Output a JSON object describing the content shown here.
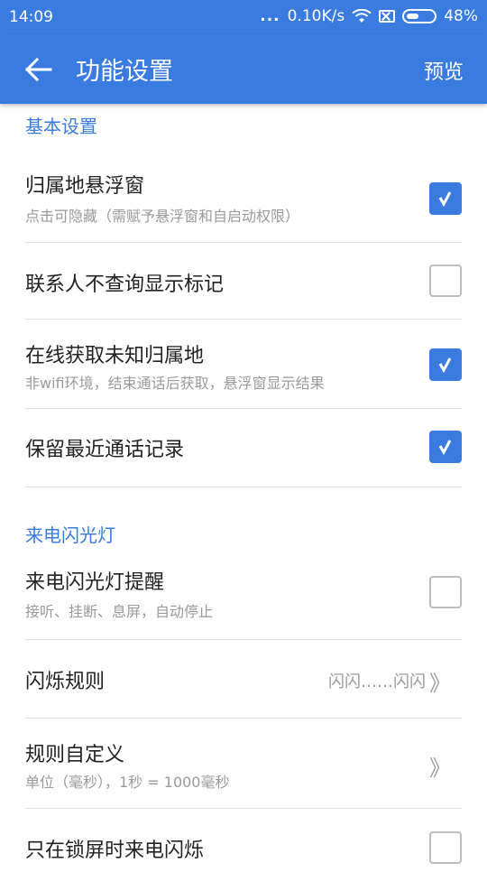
{
  "status": {
    "time": "14:09",
    "dots": "...",
    "speed": "0.10K/s",
    "battery": "48%",
    "battery_level": 0.48
  },
  "appbar": {
    "title": "功能设置",
    "preview": "预览",
    "back_icon": "arrow-left-icon"
  },
  "sections": {
    "basic": {
      "header": "基本设置",
      "items": [
        {
          "label": "归属地悬浮窗",
          "sub": "点击可隐藏（需赋予悬浮窗和自启动权限）",
          "checked": true
        },
        {
          "label": "联系人不查询显示标记",
          "checked": false
        },
        {
          "label": "在线获取未知归属地",
          "sub": "非wifi环境，结束通话后获取，悬浮窗显示结果",
          "checked": true
        },
        {
          "label": "保留最近通话记录",
          "checked": true
        }
      ]
    },
    "flash": {
      "header": "来电闪光灯",
      "items": [
        {
          "label": "来电闪光灯提醒",
          "sub": "接听、挂断、息屏，自动停止",
          "checked": false
        },
        {
          "label": "闪烁规则",
          "value": "闪闪……闪闪",
          "chevron": "》"
        },
        {
          "label": "规则自定义",
          "sub": "单位（毫秒），1秒 = 1000毫秒",
          "chevron": "》"
        },
        {
          "label": "只在锁屏时来电闪烁",
          "checked": false
        }
      ]
    }
  },
  "colors": {
    "primary": "#3a7be0",
    "text": "#222222",
    "secondary": "#9a9a9a",
    "divider": "#e4e4e4"
  }
}
